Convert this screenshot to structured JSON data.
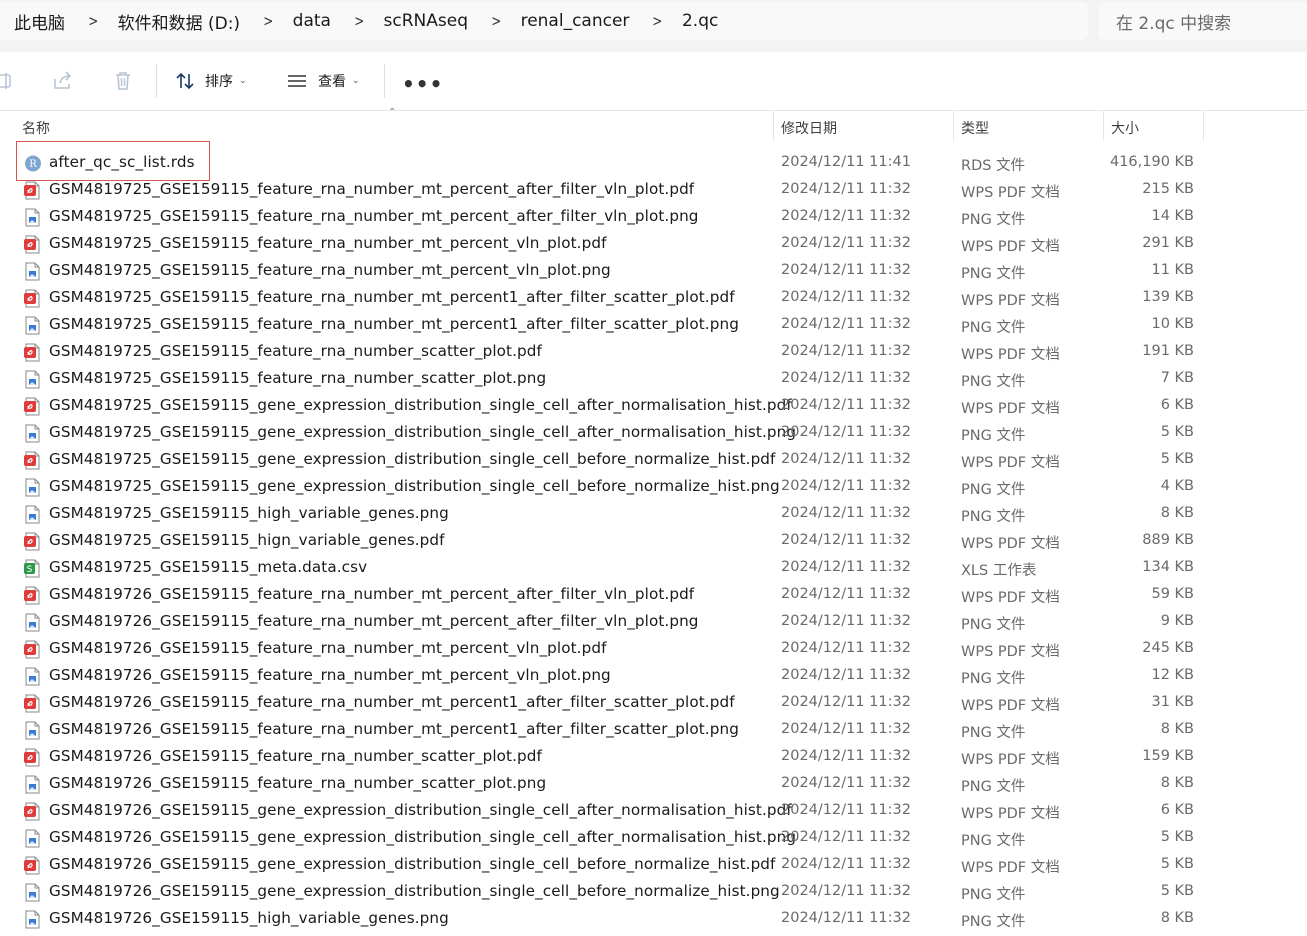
{
  "address_bar": {
    "breadcrumbs": [
      "此电脑",
      "软件和数据 (D:)",
      "data",
      "scRNAseq",
      "renal_cancer",
      "2.qc"
    ],
    "separator": ">",
    "search_placeholder": "在 2.qc 中搜索"
  },
  "toolbar": {
    "sort_label": "排序",
    "view_label": "查看",
    "more_label": "•••",
    "icons": [
      "rename-icon",
      "share-icon",
      "delete-icon",
      "sort-icon",
      "view-icon",
      "more-icon"
    ]
  },
  "columns": {
    "name": "名称",
    "date": "修改日期",
    "type": "类型",
    "size": "大小"
  },
  "colors": {
    "pdf_icon": "#e03b3b",
    "png_icon": "#3a7bd5",
    "csv_icon": "#2a9a4a",
    "rds_icon": "#7fa6cf",
    "highlight_border": "#d9534f"
  },
  "files": [
    {
      "name": "after_qc_sc_list.rds",
      "date": "2024/12/11 11:41",
      "type": "RDS 文件",
      "size": "416,190 KB",
      "icon": "rds"
    },
    {
      "name": "GSM4819725_GSE159115_feature_rna_number_mt_percent_after_filter_vln_plot.pdf",
      "date": "2024/12/11 11:32",
      "type": "WPS PDF 文档",
      "size": "215 KB",
      "icon": "pdf"
    },
    {
      "name": "GSM4819725_GSE159115_feature_rna_number_mt_percent_after_filter_vln_plot.png",
      "date": "2024/12/11 11:32",
      "type": "PNG 文件",
      "size": "14 KB",
      "icon": "png"
    },
    {
      "name": "GSM4819725_GSE159115_feature_rna_number_mt_percent_vln_plot.pdf",
      "date": "2024/12/11 11:32",
      "type": "WPS PDF 文档",
      "size": "291 KB",
      "icon": "pdf"
    },
    {
      "name": "GSM4819725_GSE159115_feature_rna_number_mt_percent_vln_plot.png",
      "date": "2024/12/11 11:32",
      "type": "PNG 文件",
      "size": "11 KB",
      "icon": "png"
    },
    {
      "name": "GSM4819725_GSE159115_feature_rna_number_mt_percent1_after_filter_scatter_plot.pdf",
      "date": "2024/12/11 11:32",
      "type": "WPS PDF 文档",
      "size": "139 KB",
      "icon": "pdf"
    },
    {
      "name": "GSM4819725_GSE159115_feature_rna_number_mt_percent1_after_filter_scatter_plot.png",
      "date": "2024/12/11 11:32",
      "type": "PNG 文件",
      "size": "10 KB",
      "icon": "png"
    },
    {
      "name": "GSM4819725_GSE159115_feature_rna_number_scatter_plot.pdf",
      "date": "2024/12/11 11:32",
      "type": "WPS PDF 文档",
      "size": "191 KB",
      "icon": "pdf"
    },
    {
      "name": "GSM4819725_GSE159115_feature_rna_number_scatter_plot.png",
      "date": "2024/12/11 11:32",
      "type": "PNG 文件",
      "size": "7 KB",
      "icon": "png"
    },
    {
      "name": "GSM4819725_GSE159115_gene_expression_distribution_single_cell_after_normalisation_hist.pdf",
      "date": "2024/12/11 11:32",
      "type": "WPS PDF 文档",
      "size": "6 KB",
      "icon": "pdf"
    },
    {
      "name": "GSM4819725_GSE159115_gene_expression_distribution_single_cell_after_normalisation_hist.png",
      "date": "2024/12/11 11:32",
      "type": "PNG 文件",
      "size": "5 KB",
      "icon": "png"
    },
    {
      "name": "GSM4819725_GSE159115_gene_expression_distribution_single_cell_before_normalize_hist.pdf",
      "date": "2024/12/11 11:32",
      "type": "WPS PDF 文档",
      "size": "5 KB",
      "icon": "pdf"
    },
    {
      "name": "GSM4819725_GSE159115_gene_expression_distribution_single_cell_before_normalize_hist.png",
      "date": "2024/12/11 11:32",
      "type": "PNG 文件",
      "size": "4 KB",
      "icon": "png"
    },
    {
      "name": "GSM4819725_GSE159115_high_variable_genes.png",
      "date": "2024/12/11 11:32",
      "type": "PNG 文件",
      "size": "8 KB",
      "icon": "png"
    },
    {
      "name": "GSM4819725_GSE159115_hign_variable_genes.pdf",
      "date": "2024/12/11 11:32",
      "type": "WPS PDF 文档",
      "size": "889 KB",
      "icon": "pdf"
    },
    {
      "name": "GSM4819725_GSE159115_meta.data.csv",
      "date": "2024/12/11 11:32",
      "type": "XLS 工作表",
      "size": "134 KB",
      "icon": "csv"
    },
    {
      "name": "GSM4819726_GSE159115_feature_rna_number_mt_percent_after_filter_vln_plot.pdf",
      "date": "2024/12/11 11:32",
      "type": "WPS PDF 文档",
      "size": "59 KB",
      "icon": "pdf"
    },
    {
      "name": "GSM4819726_GSE159115_feature_rna_number_mt_percent_after_filter_vln_plot.png",
      "date": "2024/12/11 11:32",
      "type": "PNG 文件",
      "size": "9 KB",
      "icon": "png"
    },
    {
      "name": "GSM4819726_GSE159115_feature_rna_number_mt_percent_vln_plot.pdf",
      "date": "2024/12/11 11:32",
      "type": "WPS PDF 文档",
      "size": "245 KB",
      "icon": "pdf"
    },
    {
      "name": "GSM4819726_GSE159115_feature_rna_number_mt_percent_vln_plot.png",
      "date": "2024/12/11 11:32",
      "type": "PNG 文件",
      "size": "12 KB",
      "icon": "png"
    },
    {
      "name": "GSM4819726_GSE159115_feature_rna_number_mt_percent1_after_filter_scatter_plot.pdf",
      "date": "2024/12/11 11:32",
      "type": "WPS PDF 文档",
      "size": "31 KB",
      "icon": "pdf"
    },
    {
      "name": "GSM4819726_GSE159115_feature_rna_number_mt_percent1_after_filter_scatter_plot.png",
      "date": "2024/12/11 11:32",
      "type": "PNG 文件",
      "size": "8 KB",
      "icon": "png"
    },
    {
      "name": "GSM4819726_GSE159115_feature_rna_number_scatter_plot.pdf",
      "date": "2024/12/11 11:32",
      "type": "WPS PDF 文档",
      "size": "159 KB",
      "icon": "pdf"
    },
    {
      "name": "GSM4819726_GSE159115_feature_rna_number_scatter_plot.png",
      "date": "2024/12/11 11:32",
      "type": "PNG 文件",
      "size": "8 KB",
      "icon": "png"
    },
    {
      "name": "GSM4819726_GSE159115_gene_expression_distribution_single_cell_after_normalisation_hist.pdf",
      "date": "2024/12/11 11:32",
      "type": "WPS PDF 文档",
      "size": "6 KB",
      "icon": "pdf"
    },
    {
      "name": "GSM4819726_GSE159115_gene_expression_distribution_single_cell_after_normalisation_hist.png",
      "date": "2024/12/11 11:32",
      "type": "PNG 文件",
      "size": "5 KB",
      "icon": "png"
    },
    {
      "name": "GSM4819726_GSE159115_gene_expression_distribution_single_cell_before_normalize_hist.pdf",
      "date": "2024/12/11 11:32",
      "type": "WPS PDF 文档",
      "size": "5 KB",
      "icon": "pdf"
    },
    {
      "name": "GSM4819726_GSE159115_gene_expression_distribution_single_cell_before_normalize_hist.png",
      "date": "2024/12/11 11:32",
      "type": "PNG 文件",
      "size": "5 KB",
      "icon": "png"
    },
    {
      "name": "GSM4819726_GSE159115_high_variable_genes.png",
      "date": "2024/12/11 11:32",
      "type": "PNG 文件",
      "size": "8 KB",
      "icon": "png"
    }
  ]
}
